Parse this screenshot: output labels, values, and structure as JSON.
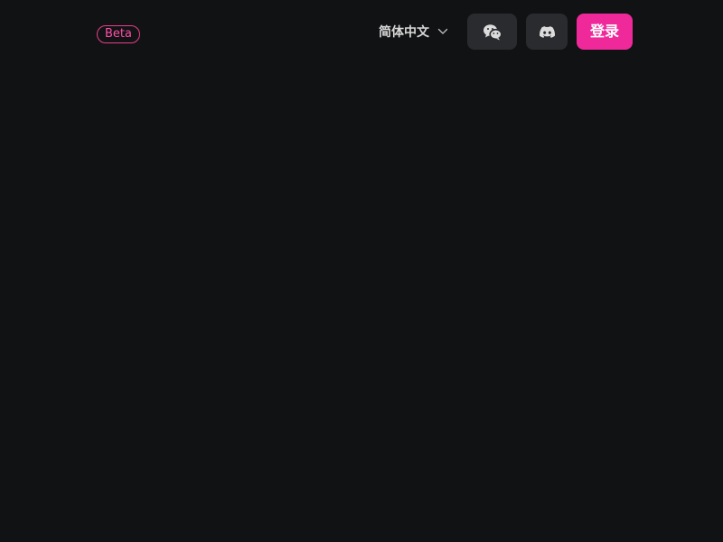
{
  "header": {
    "badge": "Beta",
    "language": {
      "selected": "简体中文",
      "icon": "chevron-down-icon"
    },
    "wechat_button": {
      "icon": "wechat-icon"
    },
    "discord_button": {
      "icon": "discord-icon"
    },
    "login_label": "登录"
  },
  "colors": {
    "background": "#111214",
    "accent": "#f0299a",
    "button_bg": "#2a2b2e"
  }
}
